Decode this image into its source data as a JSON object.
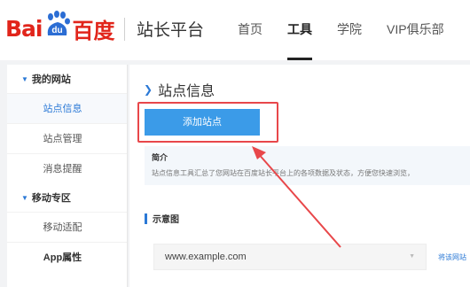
{
  "header": {
    "logo_left": "Bai",
    "logo_right": "百度",
    "logo_mark": "du",
    "site_name": "站长平台",
    "nav": [
      "首页",
      "工具",
      "学院",
      "VIP俱乐部"
    ]
  },
  "sidebar": {
    "groups": [
      {
        "label": "我的网站",
        "items": [
          "站点信息",
          "站点管理",
          "消息提醒"
        ]
      },
      {
        "label": "移动专区",
        "items": [
          "移动适配",
          "App属性"
        ]
      }
    ]
  },
  "main": {
    "title": "站点信息",
    "add_button": "添加站点",
    "intro_title": "简介",
    "intro_text": "站点信息工具汇总了您网站在百度站长平台上的各项数据及状态，方便您快速浏览，",
    "section_title": "示意图",
    "url_value": "www.example.com",
    "side_link": "将该网站"
  },
  "colors": {
    "brand_red": "#e1251b",
    "brand_blue": "#2b79d6",
    "button_blue": "#3b9be8",
    "highlight_red": "#e8474a"
  },
  "icons": {
    "caret": "caret-down-icon",
    "chevron": "chevron-down-icon",
    "dropdown": "dropdown-arrow-icon",
    "arrow": "annotation-arrow"
  }
}
